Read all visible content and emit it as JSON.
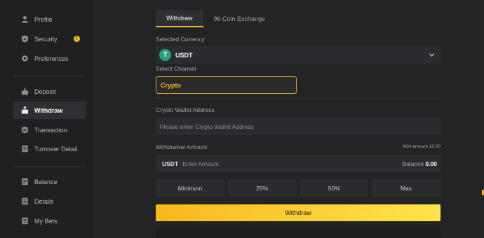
{
  "sidebar": {
    "items": [
      {
        "label": "Profile",
        "icon": "user-icon"
      },
      {
        "label": "Security",
        "icon": "shield-icon",
        "badge": "!"
      },
      {
        "label": "Preferences",
        "icon": "gear-icon"
      },
      {
        "label": "Deposit",
        "icon": "deposit-icon"
      },
      {
        "label": "Withdraw",
        "icon": "withdraw-icon"
      },
      {
        "label": "Transaction",
        "icon": "transaction-icon"
      },
      {
        "label": "Turnover Detail",
        "icon": "turnover-icon"
      },
      {
        "label": "Balance",
        "icon": "balance-icon"
      },
      {
        "label": "Details",
        "icon": "details-icon"
      },
      {
        "label": "My Bets",
        "icon": "bets-icon"
      }
    ],
    "active": "Withdraw"
  },
  "tabs": [
    {
      "label": "Withdraw",
      "active": true
    },
    {
      "label": "96 Coin Exchange",
      "active": false
    }
  ],
  "form": {
    "currency_label": "Selected Currency",
    "currency_value": "USDT",
    "currency_icon_glyph": "T",
    "channel_label": "Select Channel",
    "channel_value": "Crypto",
    "address_label": "Crypto Wallet Address",
    "address_placeholder": "Please enter Crypto Wallet Address",
    "amount_label": "Withdrawal Amount",
    "min_amount": "Mini amount 10.00",
    "amount_unit": "USDT",
    "amount_placeholder": "Enter Amount",
    "balance_label": "Balance",
    "balance_value": "0.00",
    "quick_buttons": [
      "Minimum",
      "25%",
      "50%",
      "Max"
    ],
    "submit_label": "Withdraw"
  },
  "colors": {
    "accent": "#f5b81a",
    "tether": "#26a17b",
    "background": "#232426"
  }
}
